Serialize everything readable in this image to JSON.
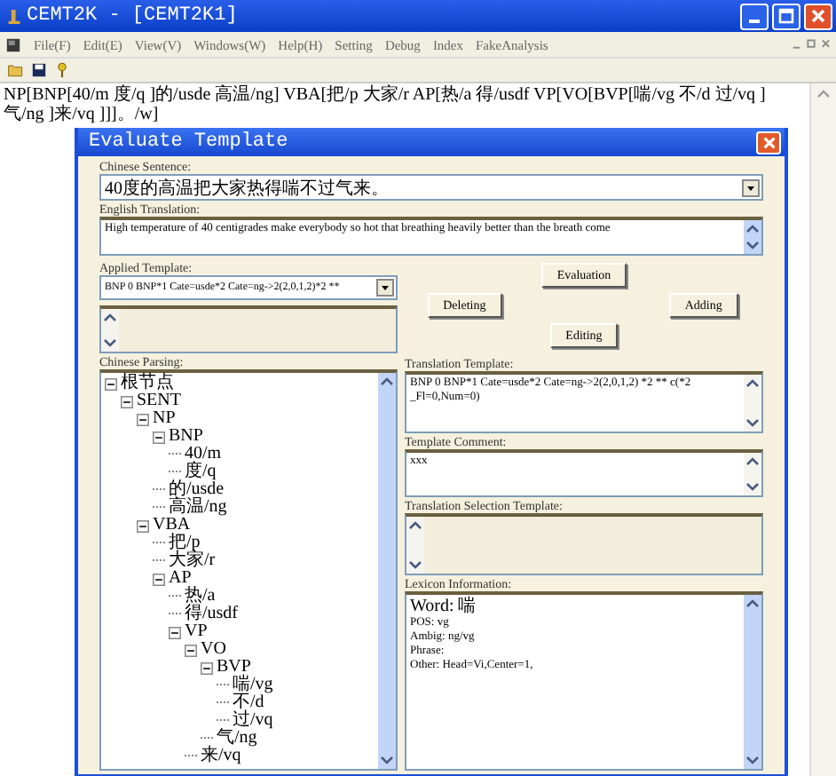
{
  "window": {
    "title": "CEMT2K - [CEMT2K1]"
  },
  "menu": [
    {
      "label": "File(F)"
    },
    {
      "label": "Edit(E)"
    },
    {
      "label": "View(V)"
    },
    {
      "label": "Windows(W)"
    },
    {
      "label": "Help(H)"
    },
    {
      "label": "Setting"
    },
    {
      "label": "Debug"
    },
    {
      "label": "Index"
    },
    {
      "label": "FakeAnalysis"
    }
  ],
  "parse_result": "NP[BNP[40/m 度/q ]的/usde 高温/ng] VBA[把/p 大家/r AP[热/a 得/usdf VP[VO[BVP[喘/vg 不/d 过/vq ]气/ng ]来/vq ]]]。/w]",
  "dialog": {
    "title": "Evaluate Template",
    "chinese_sentence": {
      "label": "Chinese Sentence:",
      "value": "40度的高温把大家热得喘不过气来。"
    },
    "english_translation": {
      "label": "English Translation:",
      "value": "High temperature of 40 centigrades make everybody so hot that breathing heavily better than the breath come"
    },
    "applied_template": {
      "label": "Applied Template:",
      "value": "BNP 0 BNP*1 Cate=usde*2 Cate=ng->2(2,0,1,2)*2 **"
    },
    "buttons": [
      {
        "label": "Evaluation"
      },
      {
        "label": "Deleting"
      },
      {
        "label": "Adding"
      },
      {
        "label": "Editing"
      }
    ],
    "chinese_parsing": {
      "label": "Chinese Parsing:",
      "tree": [
        {
          "label": "根节点",
          "expanded": true,
          "children": [
            {
              "label": "SENT",
              "expanded": true,
              "children": [
                {
                  "label": "NP",
                  "expanded": true,
                  "children": [
                    {
                      "label": "BNP",
                      "expanded": true,
                      "children": [
                        {
                          "label": "40/m"
                        },
                        {
                          "label": "度/q"
                        }
                      ]
                    },
                    {
                      "label": "的/usde"
                    },
                    {
                      "label": "高温/ng"
                    }
                  ]
                },
                {
                  "label": "VBA",
                  "expanded": true,
                  "children": [
                    {
                      "label": "把/p"
                    },
                    {
                      "label": "大家/r"
                    },
                    {
                      "label": "AP",
                      "expanded": true,
                      "children": [
                        {
                          "label": "热/a"
                        },
                        {
                          "label": "得/usdf"
                        },
                        {
                          "label": "VP",
                          "expanded": true,
                          "children": [
                            {
                              "label": "VO",
                              "expanded": true,
                              "children": [
                                {
                                  "label": "BVP",
                                  "expanded": true,
                                  "children": [
                                    {
                                      "label": "喘/vg"
                                    },
                                    {
                                      "label": "不/d"
                                    },
                                    {
                                      "label": "过/vq"
                                    }
                                  ]
                                },
                                {
                                  "label": "气/ng"
                                }
                              ]
                            },
                            {
                              "label": "来/vq"
                            }
                          ]
                        }
                      ]
                    }
                  ]
                }
              ]
            }
          ]
        }
      ]
    },
    "translation_template": {
      "label": "Translation Template:",
      "value": "BNP 0 BNP*1 Cate=usde*2 Cate=ng->2(2,0,1,2) *2 ** c(*2 _Fl=0,Num=0)"
    },
    "template_comment": {
      "label": "Template Comment:",
      "value": "xxx"
    },
    "translation_selection_template": {
      "label": "Translation Selection Template:"
    },
    "lexicon_information": {
      "label": "Lexicon Information:",
      "lines": [
        "Word: 喘",
        "POS: vg",
        "Ambig: ng/vg",
        "Phrase:",
        "Other: Head=Vi,Center=1,"
      ]
    }
  }
}
